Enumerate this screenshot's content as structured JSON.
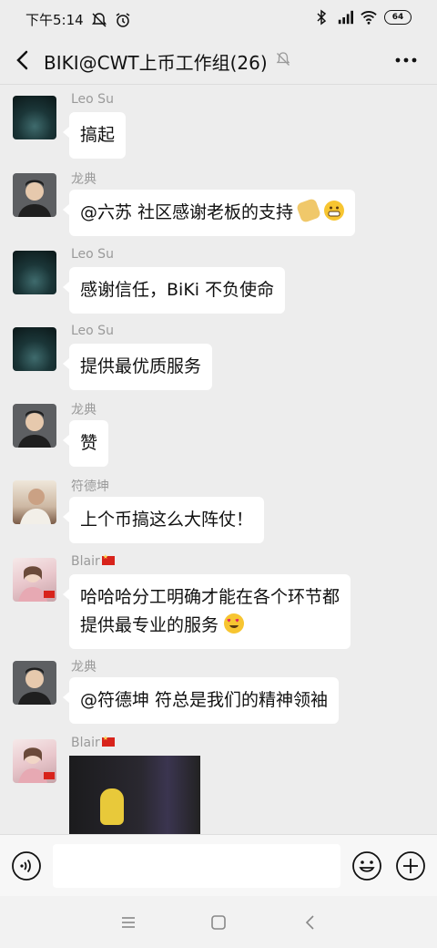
{
  "status_bar": {
    "time": "下午5:14",
    "battery": "64"
  },
  "header": {
    "title": "BIKI@CWT上币工作组(26)"
  },
  "messages": [
    {
      "sender": "Leo Su",
      "text": "搞起"
    },
    {
      "sender": "龙典",
      "text": "@六苏  社区感谢老板的支持"
    },
    {
      "sender": "Leo Su",
      "text": "感谢信任，BiKi 不负使命"
    },
    {
      "sender": "Leo Su",
      "text": "提供最优质服务"
    },
    {
      "sender": "龙典",
      "text": "赞"
    },
    {
      "sender": "符德坤",
      "text": "上个币搞这么大阵仗！"
    },
    {
      "sender": "Blair",
      "line1": "哈哈哈分工明确才能在各个环节都",
      "line2": "提供最专业的服务"
    },
    {
      "sender": "龙典",
      "text": "@符德坤  符总是我们的精神领袖"
    },
    {
      "sender": "Blair",
      "type": "image"
    }
  ],
  "input": {
    "placeholder": ""
  },
  "icons": {
    "back": "back-arrow-icon",
    "mute": "bell-off-icon",
    "more": "more-dots-icon",
    "voice": "voice-icon",
    "emoji": "emoji-icon",
    "plus": "plus-icon"
  },
  "colors": {
    "background": "#ededed",
    "bubble": "#ffffff",
    "sender_name": "#9a9a9a"
  }
}
